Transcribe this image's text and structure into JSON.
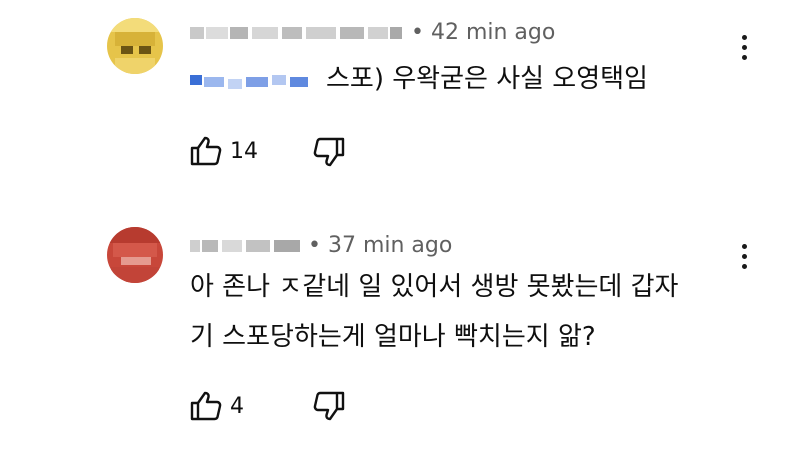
{
  "comments": [
    {
      "time": "• 42 min ago",
      "text_lines": [
        "스포) 우왁굳은 사실 오영택임"
      ],
      "likes": "14",
      "avatar_color": "#e6c44a"
    },
    {
      "time": "• 37 min ago",
      "text_lines": [
        "아 존나 ㅈ같네 일 있어서 생방 못봤는데 갑자",
        "기 스포당하는게 얼마나 빡치는지 앎?"
      ],
      "likes": "4",
      "avatar_color": "#c8473a"
    }
  ],
  "icons": {
    "like": "thumb-up-icon",
    "dislike": "thumb-down-icon",
    "menu": "more-vert-icon"
  }
}
